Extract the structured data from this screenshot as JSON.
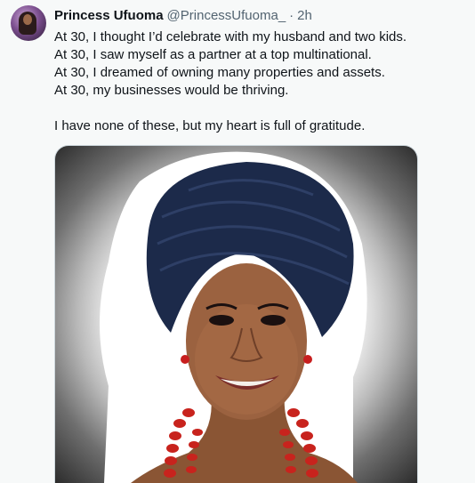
{
  "tweet": {
    "display_name": "Princess Ufuoma",
    "handle": "@PrincessUfuoma_",
    "separator": "·",
    "time": "2h",
    "lines": [
      "At 30, I thought I’d celebrate with my husband and two kids.",
      "At 30, I saw myself as a partner at a top multinational.",
      "At 30, I dreamed of owning many properties and assets.",
      "At 30, my businesses would be thriving."
    ],
    "closing": "I have none of these, but my heart is full of gratitude."
  },
  "colors": {
    "background": "#f7f9f9",
    "text": "#0f1419",
    "secondary_text": "#536471",
    "border": "#cfd9de"
  }
}
